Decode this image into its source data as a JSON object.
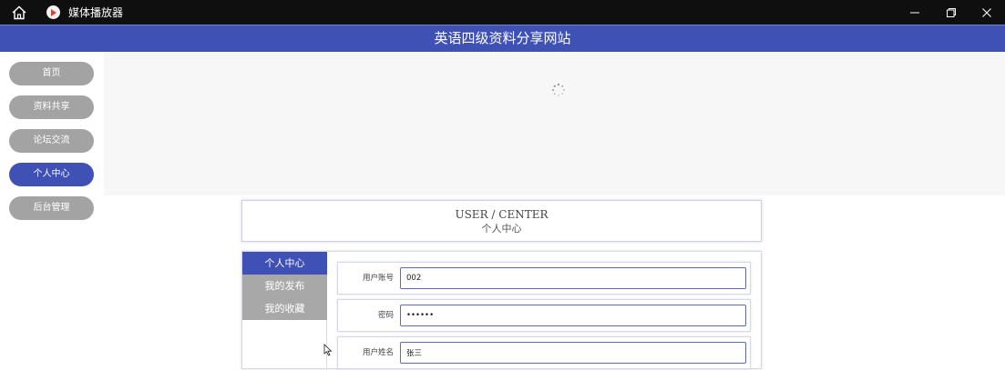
{
  "window": {
    "title": "媒体播放器",
    "icons": {
      "home": "home-icon",
      "app": "media-player-logo-icon",
      "minimize": "minimize-icon",
      "maximize": "restore-icon",
      "close": "close-icon"
    }
  },
  "header": {
    "title": "英语四级资料分享网站"
  },
  "sidebar": {
    "items": [
      {
        "label": "首页",
        "active": false
      },
      {
        "label": "资料共享",
        "active": false
      },
      {
        "label": "论坛交流",
        "active": false
      },
      {
        "label": "个人中心",
        "active": true
      },
      {
        "label": "后台管理",
        "active": false
      }
    ]
  },
  "card": {
    "title_en": "USER / CENTER",
    "title_zh": "个人中心"
  },
  "tabs": [
    {
      "label": "个人中心",
      "active": true
    },
    {
      "label": "我的发布",
      "active": false
    },
    {
      "label": "我的收藏",
      "active": false
    }
  ],
  "form": {
    "fields": [
      {
        "label": "用户账号",
        "value": "002"
      },
      {
        "label": "密码",
        "value": "••••••"
      },
      {
        "label": "用户姓名",
        "value": "张三"
      }
    ]
  },
  "colors": {
    "accent": "#3f51b5",
    "inactive": "#a3a3a3",
    "titlebar": "#0f0f0f"
  }
}
